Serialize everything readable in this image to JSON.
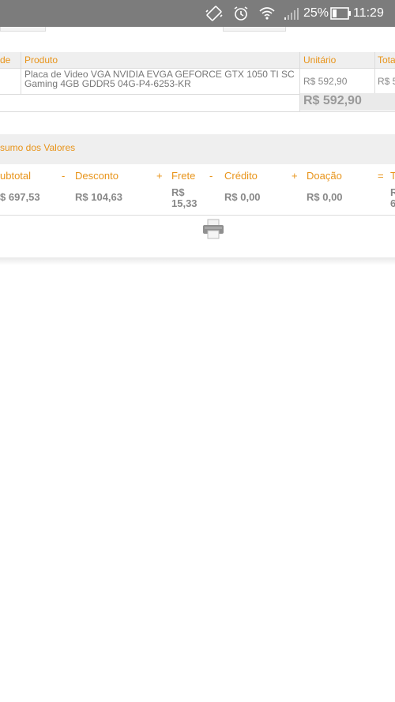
{
  "status_bar": {
    "battery_percent": "25%",
    "time": "11:29",
    "icons": [
      "vibrate-icon",
      "alarm-icon",
      "wifi-icon",
      "signal-icon",
      "battery-icon"
    ]
  },
  "products_table": {
    "headers": {
      "qty": "de",
      "product": "Produto",
      "unit": "Unitário",
      "total": "Tota"
    },
    "rows": [
      {
        "product": "Placa de Video VGA NVIDIA EVGA GEFORCE GTX 1050 TI SC Gaming 4GB GDDR5 04G-P4-6253-KR",
        "unit": "R$ 592,90",
        "total": "R$ 5"
      }
    ],
    "grand_total": "R$ 592,90"
  },
  "summary": {
    "title": "sumo dos Valores",
    "labels": {
      "subtotal": "ubtotal",
      "desconto": "Desconto",
      "frete": "Frete",
      "credito": "Crédito",
      "doacao": "Doação",
      "total": "T"
    },
    "operators": [
      "-",
      "+",
      "-",
      "+",
      "="
    ],
    "values": {
      "subtotal": "$ 697,53",
      "desconto": "R$ 104,63",
      "frete_line1": "R$",
      "frete_line2": "15,33",
      "credito": "R$ 0,00",
      "doacao": "R$ 0,00",
      "total_line1": "R",
      "total_line2": "6"
    }
  },
  "colors": {
    "accent": "#e8941a",
    "status_bar": "#7c7c7c",
    "muted_text": "#888888"
  }
}
